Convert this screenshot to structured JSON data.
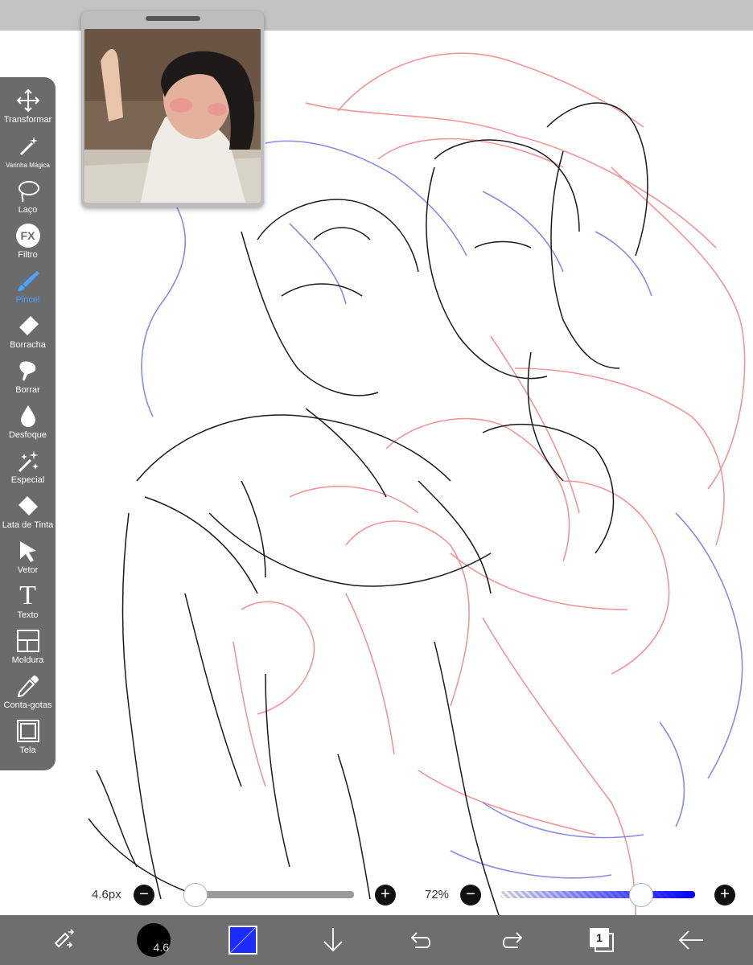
{
  "tools": [
    {
      "label": "Transformar",
      "icon": "move-arrows-icon"
    },
    {
      "label": "Varinha Mágica",
      "icon": "magic-wand-icon"
    },
    {
      "label": "Laço",
      "icon": "lasso-icon"
    },
    {
      "label": "Filtro",
      "icon": "fx-icon",
      "icon_text": "FX"
    },
    {
      "label": "Pincel",
      "icon": "brush-icon"
    },
    {
      "label": "Borracha",
      "icon": "eraser-icon"
    },
    {
      "label": "Borrar",
      "icon": "smudge-finger-icon"
    },
    {
      "label": "Desfoque",
      "icon": "blur-drop-icon"
    },
    {
      "label": "Especial",
      "icon": "sparkle-brush-icon"
    },
    {
      "label": "Lata de Tinta",
      "icon": "paint-bucket-icon"
    },
    {
      "label": "Vetor",
      "icon": "vector-cursor-icon"
    },
    {
      "label": "Texto",
      "icon": "text-t-icon",
      "icon_text": "T"
    },
    {
      "label": "Moldura",
      "icon": "frame-panels-icon"
    },
    {
      "label": "Conta-gotas",
      "icon": "eyedropper-icon"
    },
    {
      "label": "Tela",
      "icon": "canvas-square-icon"
    }
  ],
  "active_tool": "Pincel",
  "brush": {
    "size_label": "4.6px",
    "size_fraction": 0.0
  },
  "opacity": {
    "label": "72%",
    "fraction": 0.72
  },
  "bottombar": {
    "brush_size_value": "4.6",
    "current_color": "#1e2bff",
    "layer_count": "1"
  },
  "colors": {
    "accent": "#4aa3ff",
    "toolbar_bg": "#6b6b6b",
    "bottombar_bg": "#6e6e6e"
  },
  "slider_glyphs": {
    "minus": "−",
    "plus": "+"
  }
}
